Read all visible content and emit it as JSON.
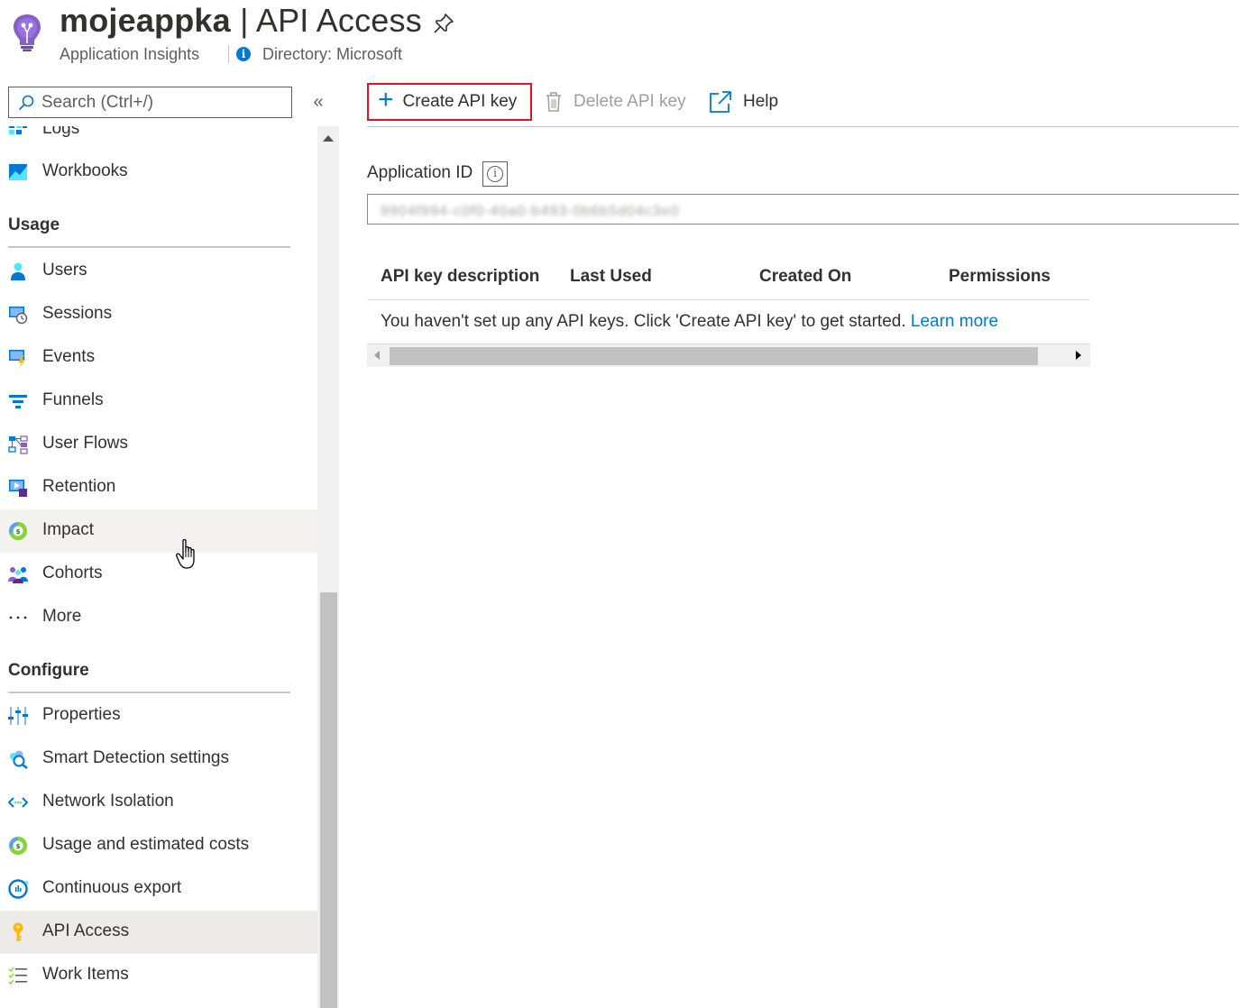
{
  "header": {
    "app_name": "mojeappka",
    "separator": " | ",
    "page_name": "API Access",
    "resource_type": "Application Insights",
    "directory": "Directory: Microsoft"
  },
  "search": {
    "placeholder": "Search (Ctrl+/)",
    "collapse_glyph": "«"
  },
  "sidebar": {
    "top_items": [
      {
        "label": "Logs",
        "icon": "logs-icon"
      },
      {
        "label": "Workbooks",
        "icon": "workbooks-icon"
      }
    ],
    "usage_heading": "Usage",
    "usage_items": [
      {
        "label": "Users",
        "icon": "users-icon"
      },
      {
        "label": "Sessions",
        "icon": "sessions-icon"
      },
      {
        "label": "Events",
        "icon": "events-icon"
      },
      {
        "label": "Funnels",
        "icon": "funnels-icon"
      },
      {
        "label": "User Flows",
        "icon": "user-flows-icon"
      },
      {
        "label": "Retention",
        "icon": "retention-icon"
      },
      {
        "label": "Impact",
        "icon": "impact-icon"
      },
      {
        "label": "Cohorts",
        "icon": "cohorts-icon"
      },
      {
        "label": "More",
        "icon": "more-icon"
      }
    ],
    "configure_heading": "Configure",
    "configure_items": [
      {
        "label": "Properties",
        "icon": "properties-icon"
      },
      {
        "label": "Smart Detection settings",
        "icon": "smart-detection-icon"
      },
      {
        "label": "Network Isolation",
        "icon": "network-isolation-icon"
      },
      {
        "label": "Usage and estimated costs",
        "icon": "usage-costs-icon"
      },
      {
        "label": "Continuous export",
        "icon": "continuous-export-icon"
      },
      {
        "label": "API Access",
        "icon": "key-icon"
      },
      {
        "label": "Work Items",
        "icon": "work-items-icon"
      }
    ],
    "hovered_item": "Impact",
    "selected_item": "API Access"
  },
  "toolbar": {
    "create_label": "Create API key",
    "delete_label": "Delete API key",
    "help_label": "Help"
  },
  "application_id": {
    "label": "Application ID",
    "value_masked": "9904f994-c0f0-40a0-b493-0b6b5d04c3e0"
  },
  "table": {
    "columns": [
      "API key description",
      "Last Used",
      "Created On",
      "Permissions"
    ],
    "empty_message": "You haven't set up any API keys. Click 'Create API key' to get started. ",
    "learn_more": "Learn more"
  },
  "colors": {
    "accent": "#0078d4",
    "highlight_border": "#e81123",
    "selected_bg": "#edebe9",
    "hover_bg": "#f3f2f1"
  }
}
